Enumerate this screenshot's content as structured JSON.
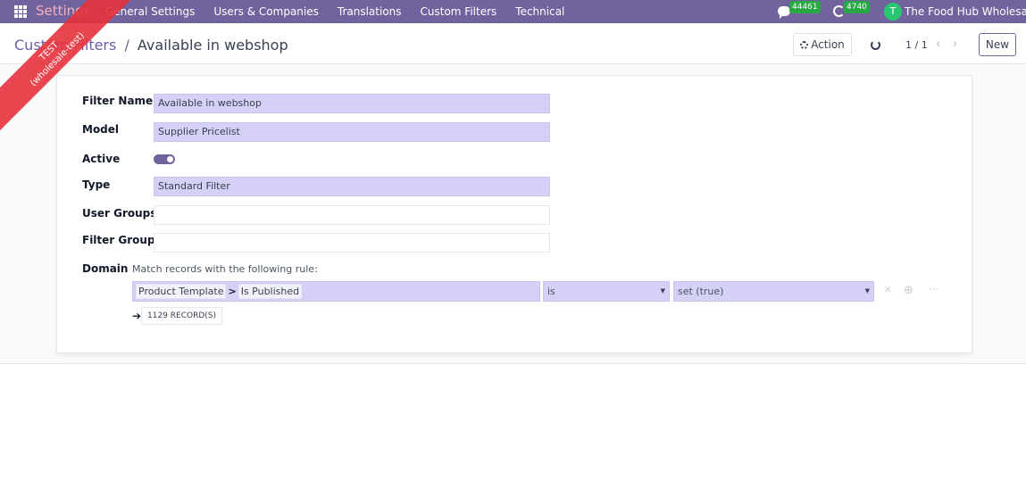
{
  "navbar": {
    "app_name": "Settings",
    "menu": [
      "General Settings",
      "Users & Companies",
      "Translations",
      "Custom Filters",
      "Technical"
    ],
    "messages_count": "44461",
    "activities_count": "4740",
    "company_initial": "T",
    "company_name": "The Food Hub Wholesale"
  },
  "ribbon": {
    "line1": "TEST",
    "line2": "(wholesale-test)"
  },
  "control": {
    "breadcrumb_parent": "Custom Filters",
    "breadcrumb_separator": "/",
    "breadcrumb_current": "Available in webshop",
    "action_label": "Action",
    "pager": "1 / 1",
    "new_label": "New"
  },
  "form": {
    "filter_name_label": "Filter Name",
    "filter_name_value": "Available in webshop",
    "model_label": "Model",
    "model_value": "Supplier Pricelist",
    "active_label": "Active",
    "active_value": true,
    "type_label": "Type",
    "type_value": "Standard Filter",
    "user_groups_label": "User Groups",
    "user_groups_value": "",
    "filter_group_label": "Filter Group",
    "filter_group_value": "",
    "domain_label": "Domain",
    "domain_description": "Match records with the following rule:",
    "domain_rule": {
      "path": [
        "Product Template",
        "Is Published"
      ],
      "path_separator": ">",
      "operator": "is",
      "value": "set (true)"
    },
    "records_label": "1129 RECORD(S)"
  },
  "colors": {
    "navbar": "#71639e",
    "field_highlight": "#d5d0f5",
    "ribbon": "#e6323c",
    "company_avatar": "#28c76f",
    "badge": "#28a745"
  }
}
